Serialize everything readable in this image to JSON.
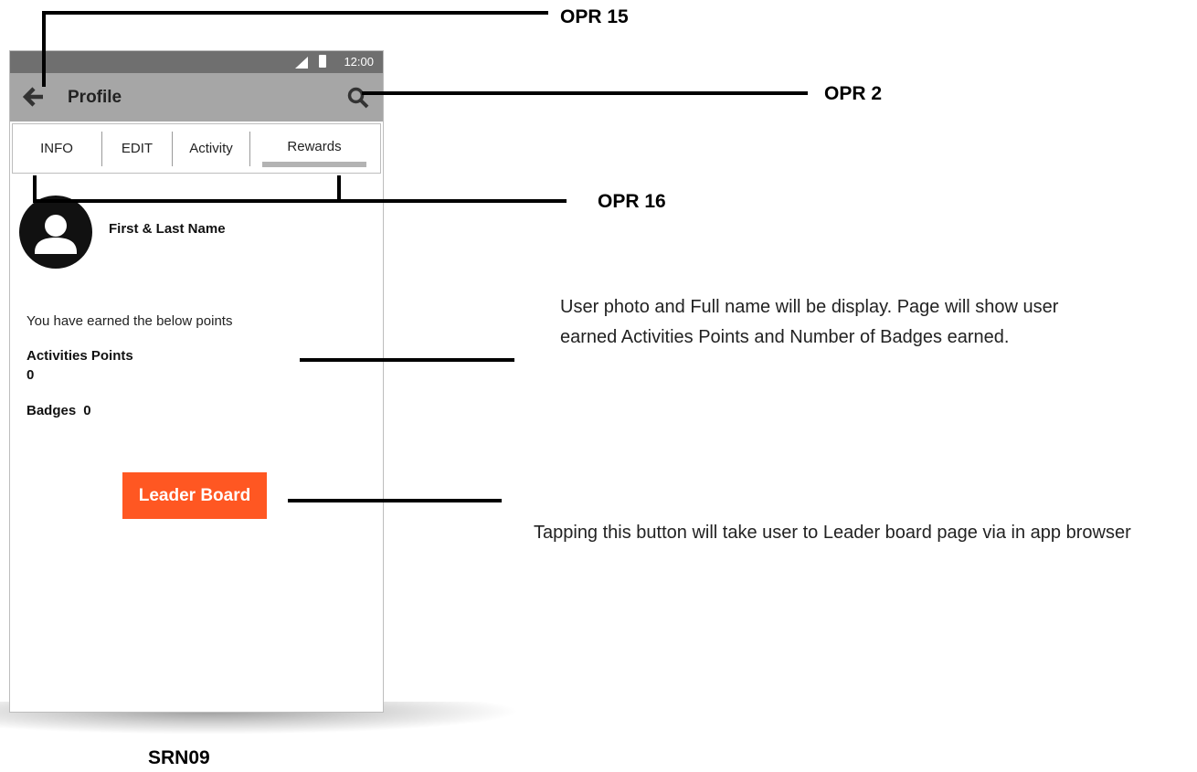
{
  "status_bar": {
    "time": "12:00"
  },
  "app_bar": {
    "title": "Profile",
    "back_icon": "arrow-left-icon",
    "search_icon": "search-icon"
  },
  "tabs": [
    {
      "label": "INFO"
    },
    {
      "label": "EDIT"
    },
    {
      "label": "Activity"
    },
    {
      "label": "Rewards",
      "selected": true
    }
  ],
  "profile": {
    "name": "First & Last Name",
    "avatar_icon": "person-icon"
  },
  "rewards": {
    "intro": "You have earned the below points",
    "activities_label": "Activities Points",
    "activities_value": "0",
    "badges_label": "Badges",
    "badges_value": "0"
  },
  "leader_button": {
    "label": "Leader Board",
    "color": "#ff5722"
  },
  "annotations": {
    "opr15": "OPR 15",
    "opr2": "OPR 2",
    "opr16": "OPR 16",
    "note_profile": "User photo and Full name will be display. Page will show user earned Activities Points and Number of Badges earned.",
    "note_button": "Tapping this button will take user to Leader board page via in app browser",
    "screen_id": "SRN09"
  }
}
